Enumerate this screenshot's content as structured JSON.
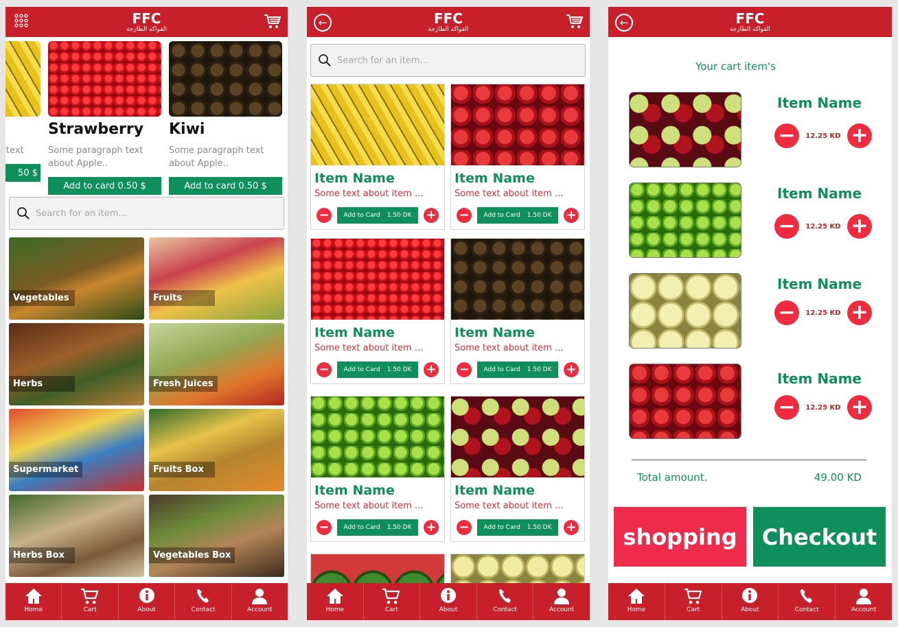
{
  "brand": {
    "name": "FFC",
    "subtitle": "الفواكه الطازجة"
  },
  "colors": {
    "header": "#c8202a",
    "accent_green": "#0f8f5b",
    "accent_red": "#ee2b3f"
  },
  "search": {
    "placeholder": "Search for an item..."
  },
  "nav": [
    "Home",
    "Cart",
    "About",
    "Contact",
    "Account"
  ],
  "home": {
    "featured": [
      {
        "title": "",
        "para": "text",
        "button": "50 $"
      },
      {
        "title": "Strawberry",
        "para": "Some paragraph text about Apple..",
        "button": "Add to card 0.50 $"
      },
      {
        "title": "Kiwi",
        "para": "Some paragraph text about Apple..",
        "button": "Add to card 0.50 $"
      }
    ],
    "categories": [
      "Vegetables",
      "Fruits",
      "Herbs",
      "Fresh Juices",
      "Supermarket",
      "Fruits Box",
      "Herbs Box",
      "Vegetables Box"
    ]
  },
  "listing": {
    "items": [
      {
        "name": "Item Name",
        "desc": "Some text about item ...",
        "add": "Add to Card",
        "price": "1.50 DK"
      },
      {
        "name": "Item Name",
        "desc": "Some text about item ...",
        "add": "Add to Card",
        "price": "1.50 DK"
      },
      {
        "name": "Item Name",
        "desc": "Some text about item ...",
        "add": "Add to Card",
        "price": "1.50 DK"
      },
      {
        "name": "Item Name",
        "desc": "Some text about item ...",
        "add": "Add to Card",
        "price": "1.50 DK"
      },
      {
        "name": "Item Name",
        "desc": "Some text about item ...",
        "add": "Add to Card",
        "price": "1.50 DK"
      },
      {
        "name": "Item Name",
        "desc": "Some text about item ...",
        "add": "Add to Card",
        "price": "1.50 DK"
      }
    ]
  },
  "cart": {
    "title": "Your cart item's",
    "items": [
      {
        "name": "Item Name",
        "price": "12.25 KD"
      },
      {
        "name": "Item Name",
        "price": "12.25 KD"
      },
      {
        "name": "Item Name",
        "price": "12.25 KD"
      },
      {
        "name": "Item Name",
        "price": "12.25 KD"
      }
    ],
    "total_label": "Total amount.",
    "total_value": "49.00 KD",
    "shopping_label": "shopping",
    "checkout_label": "Checkout"
  }
}
